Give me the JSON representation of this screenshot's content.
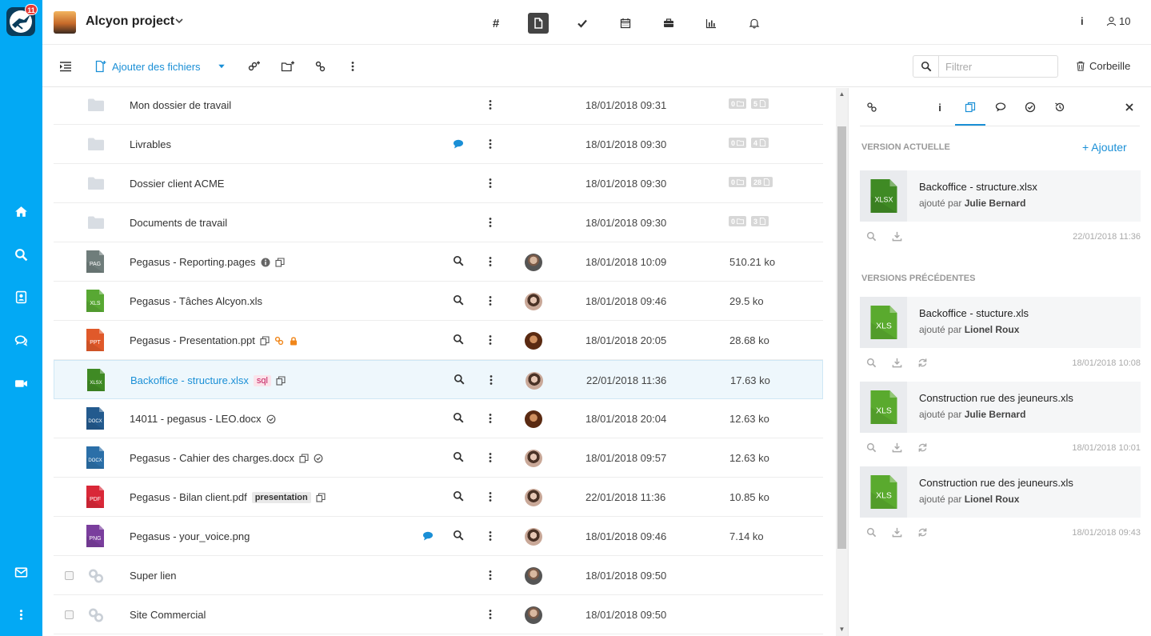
{
  "app": {
    "badge_count": "11"
  },
  "header": {
    "project_title": "Alcyon project",
    "nav_icons": [
      "hash-icon",
      "file-icon",
      "check-icon",
      "calendar-icon",
      "briefcase-icon",
      "chart-icon",
      "bell-icon"
    ],
    "active_nav": "file-icon",
    "hash_label": "#",
    "info_label": "i",
    "members_count": "10"
  },
  "toolbar": {
    "add_files_label": "Ajouter des fichiers",
    "filter_placeholder": "Filtrer",
    "trash_label": "Corbeille"
  },
  "files": [
    {
      "type": "folder",
      "name": "Mon dossier de travail",
      "date": "18/01/2018 09:31",
      "folders": "0",
      "files": "5"
    },
    {
      "type": "folder",
      "name": "Livrables",
      "date": "18/01/2018 09:30",
      "folders": "0",
      "files": "4",
      "comment": true
    },
    {
      "type": "folder",
      "name": "Dossier client ACME",
      "date": "18/01/2018 09:30",
      "folders": "0",
      "files": "28"
    },
    {
      "type": "folder",
      "name": "Documents de travail",
      "date": "18/01/2018 09:30",
      "folders": "0",
      "files": "3"
    },
    {
      "type": "file",
      "ext": "PAG",
      "color": "#6f7d7b",
      "name": "Pegasus - Reporting.pages",
      "date": "18/01/2018 10:09",
      "size": "510.21 ko",
      "avatar": "m"
    },
    {
      "type": "file",
      "ext": "XLS",
      "color": "#58a833",
      "name": "Pegasus - Tâches Alcyon.xls",
      "date": "18/01/2018 09:46",
      "size": "29.5 ko",
      "avatar": "f"
    },
    {
      "type": "file",
      "ext": "PPT",
      "color": "#e0592a",
      "name": "Pegasus - Presentation.ppt",
      "date": "18/01/2018 20:05",
      "size": "28.68 ko",
      "avatar": "d"
    },
    {
      "type": "file",
      "ext": "XLSX",
      "color": "#3f8a24",
      "name": "Backoffice - structure.xlsx",
      "tag": "sql",
      "date": "22/01/2018 11:36",
      "size": "17.63 ko",
      "avatar": "f",
      "selected": true
    },
    {
      "type": "file",
      "ext": "DOCX",
      "color": "#235a8e",
      "name": "14011 - pegasus - LEO.docx",
      "date": "18/01/2018 20:04",
      "size": "12.63 ko",
      "avatar": "d"
    },
    {
      "type": "file",
      "ext": "DOCX",
      "color": "#2b6fa8",
      "name": "Pegasus - Cahier des charges.docx",
      "date": "18/01/2018 09:57",
      "size": "12.63 ko",
      "avatar": "f"
    },
    {
      "type": "file",
      "ext": "PDF",
      "color": "#d92838",
      "name": "Pegasus - Bilan client.pdf",
      "tag": "presentation",
      "date": "22/01/2018 11:36",
      "size": "10.85 ko",
      "avatar": "f"
    },
    {
      "type": "file",
      "ext": "PNG",
      "color": "#7a3e9d",
      "name": "Pegasus - your_voice.png",
      "date": "18/01/2018 09:46",
      "size": "7.14 ko",
      "avatar": "f",
      "comment": true
    },
    {
      "type": "link",
      "name": "Super lien",
      "date": "18/01/2018 09:50",
      "avatar": "m"
    },
    {
      "type": "link",
      "name": "Site Commercial",
      "date": "18/01/2018 09:50",
      "avatar": "m"
    }
  ],
  "panel": {
    "tabs": [
      "link-icon",
      "info-icon",
      "versions-icon",
      "comments-icon",
      "check-circle-icon",
      "history-icon",
      "close-icon"
    ],
    "current_section": "VERSION ACTUELLE",
    "add_label": "+ Ajouter",
    "previous_section": "VERSIONS PRÉCÉDENTES",
    "current": {
      "ext": "XLSX",
      "name": "Backoffice - structure.xlsx",
      "by_prefix": "ajouté par",
      "author": "Julie Bernard",
      "date": "22/01/2018 11:36"
    },
    "previous": [
      {
        "ext": "XLS",
        "name": "Backoffice - stucture.xls",
        "by_prefix": "ajouté par",
        "author": "Lionel Roux",
        "date": "18/01/2018 10:08"
      },
      {
        "ext": "XLS",
        "name": "Construction rue des jeuneurs.xls",
        "by_prefix": "ajouté par",
        "author": "Julie Bernard",
        "date": "18/01/2018 10:01"
      },
      {
        "ext": "XLS",
        "name": "Construction rue des jeuneurs.xls",
        "by_prefix": "ajouté par",
        "author": "Lionel Roux",
        "date": "18/01/2018 09:43"
      }
    ]
  },
  "colors": {
    "accent": "#03a9f4",
    "link": "#1a8fd6",
    "selected_row": "#eef7fc"
  }
}
